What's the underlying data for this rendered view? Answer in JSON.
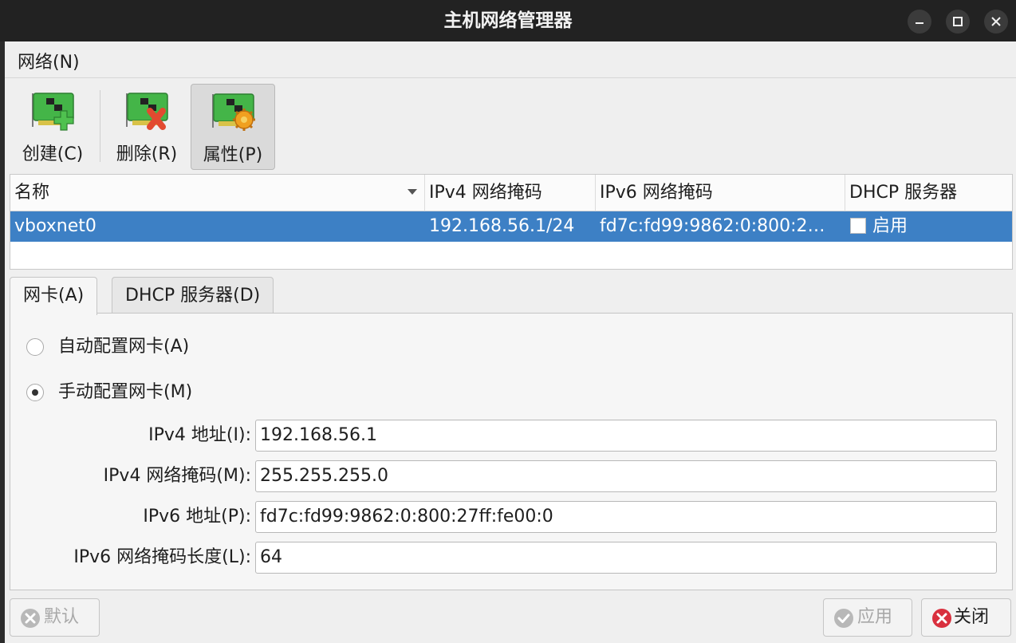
{
  "window": {
    "title": "主机网络管理器"
  },
  "menu": {
    "network": "网络(N)"
  },
  "toolbar": {
    "create": "创建(C)",
    "delete": "删除(R)",
    "properties": "属性(P)"
  },
  "table": {
    "headers": [
      "名称",
      "IPv4 网络掩码",
      "IPv6 网络掩码",
      "DHCP 服务器"
    ],
    "rows": [
      {
        "name": "vboxnet0",
        "ipv4_mask": "192.168.56.1/24",
        "ipv6_mask": "fd7c:fd99:9862:0:800:2…",
        "dhcp_checked": false,
        "dhcp": "启用"
      }
    ]
  },
  "tabs": {
    "adapter": "网卡(A)",
    "dhcp": "DHCP 服务器(D)"
  },
  "adapter": {
    "auto_label": "自动配置网卡(A)",
    "auto_checked": false,
    "manual_label": "手动配置网卡(M)",
    "manual_checked": true,
    "ipv4_addr_label": "IPv4 地址(I):",
    "ipv4_addr": "192.168.56.1",
    "ipv4_mask_label": "IPv4 网络掩码(M):",
    "ipv4_mask": "255.255.255.0",
    "ipv6_addr_label": "IPv6 地址(P):",
    "ipv6_addr": "fd7c:fd99:9862:0:800:27ff:fe00:0",
    "ipv6_len_label": "IPv6 网络掩码长度(L):",
    "ipv6_len": "64"
  },
  "buttons": {
    "reset": "默认",
    "apply": "应用",
    "close": "关闭"
  },
  "colors": {
    "selection": "#3d80c5",
    "close_icon": "#d9303e",
    "nic_green": "#44b548"
  }
}
